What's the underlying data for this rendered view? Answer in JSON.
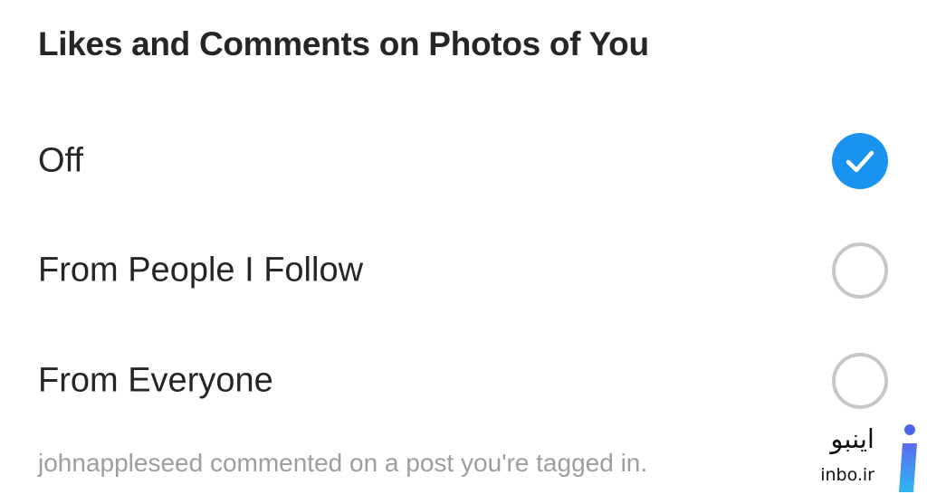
{
  "section": {
    "title": "Likes and Comments on Photos of You"
  },
  "options": [
    {
      "label": "Off",
      "selected": true
    },
    {
      "label": "From People I Follow",
      "selected": false
    },
    {
      "label": "From Everyone",
      "selected": false
    }
  ],
  "example": {
    "text": "johnappleseed commented on a post you're tagged in."
  },
  "watermark": {
    "text_fa": "اینبو",
    "text_en": "inbo.ir",
    "logo_icon": "inbo-logo-icon"
  },
  "colors": {
    "accent": "#1a93f0",
    "text": "#262626",
    "muted": "#9e9e9e",
    "radio_border": "#c7c7c7"
  }
}
